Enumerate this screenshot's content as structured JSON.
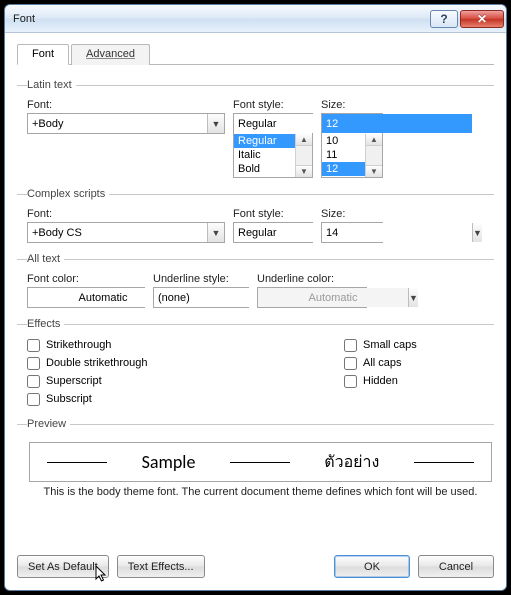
{
  "titlebar": {
    "title": "Font"
  },
  "tabs": {
    "font": "Font",
    "advanced": "Advanced"
  },
  "latin": {
    "legend": "Latin text",
    "font_label": "Font:",
    "font_value": "+Body",
    "style_label": "Font style:",
    "style_value": "Regular",
    "style_options": [
      "Regular",
      "Italic",
      "Bold"
    ],
    "size_label": "Size:",
    "size_value": "12",
    "size_options": [
      "10",
      "11",
      "12"
    ]
  },
  "complex": {
    "legend": "Complex scripts",
    "font_label": "Font:",
    "font_value": "+Body CS",
    "style_label": "Font style:",
    "style_value": "Regular",
    "size_label": "Size:",
    "size_value": "14"
  },
  "alltext": {
    "legend": "All text",
    "fontcolor_label": "Font color:",
    "fontcolor_value": "Automatic",
    "underlinestyle_label": "Underline style:",
    "underlinestyle_value": "(none)",
    "underlinecolor_label": "Underline color:",
    "underlinecolor_value": "Automatic"
  },
  "effects": {
    "legend": "Effects",
    "strike": "Strikethrough",
    "dblstrike": "Double strikethrough",
    "superscript": "Superscript",
    "subscript": "Subscript",
    "smallcaps": "Small caps",
    "allcaps": "All caps",
    "hidden": "Hidden"
  },
  "preview": {
    "legend": "Preview",
    "sample1": "Sample",
    "sample2": "ตัวอย่าง",
    "desc": "This is the body theme font. The current document theme defines which font will be used."
  },
  "buttons": {
    "setdefault": "Set As Default",
    "texteffects": "Text Effects...",
    "ok": "OK",
    "cancel": "Cancel"
  }
}
